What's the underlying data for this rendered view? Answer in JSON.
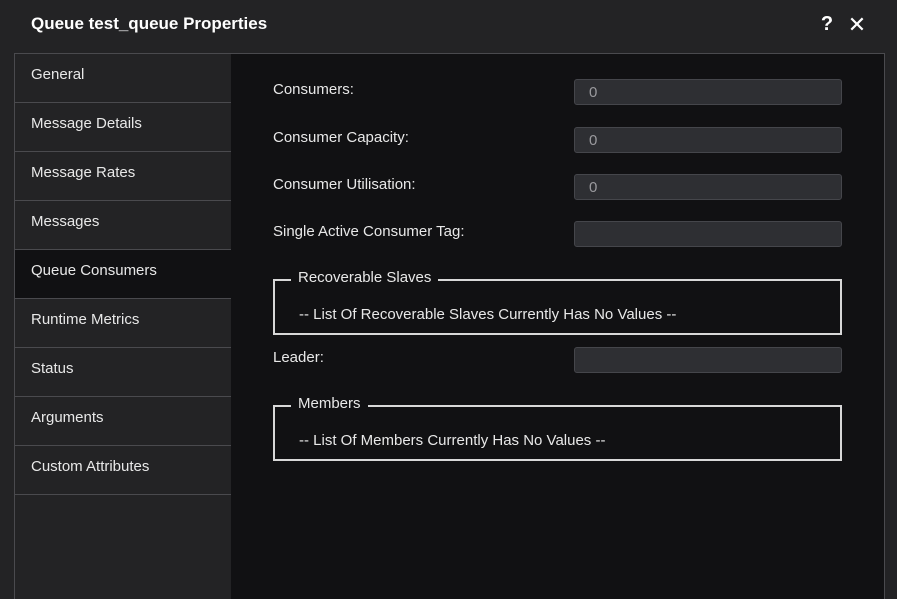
{
  "window": {
    "title": "Queue test_queue Properties",
    "help_icon": "question-mark-icon",
    "close_icon": "close-icon"
  },
  "sidebar": {
    "items": [
      {
        "label": "General",
        "active": false
      },
      {
        "label": "Message Details",
        "active": false
      },
      {
        "label": "Message Rates",
        "active": false
      },
      {
        "label": "Messages",
        "active": false
      },
      {
        "label": "Queue Consumers",
        "active": true
      },
      {
        "label": "Runtime Metrics",
        "active": false
      },
      {
        "label": "Status",
        "active": false
      },
      {
        "label": "Arguments",
        "active": false
      },
      {
        "label": "Custom Attributes",
        "active": false
      }
    ]
  },
  "main": {
    "fields": {
      "consumers": {
        "label": "Consumers:",
        "value": "0"
      },
      "consumer_capacity": {
        "label": "Consumer Capacity:",
        "value": "0"
      },
      "consumer_utilisation": {
        "label": "Consumer Utilisation:",
        "value": "0"
      },
      "single_active_consumer_tag": {
        "label": "Single Active Consumer Tag:",
        "value": ""
      },
      "leader": {
        "label": "Leader:",
        "value": ""
      }
    },
    "recoverable_slaves": {
      "legend": "Recoverable Slaves",
      "empty_text": "-- List Of Recoverable Slaves Currently Has No Values --"
    },
    "members": {
      "legend": "Members",
      "empty_text": "-- List Of Members Currently Has No Values --"
    }
  },
  "colors": {
    "window_bg": "#232325",
    "content_bg": "#111113",
    "input_bg": "#2e2f33",
    "border": "#4a4a4e"
  }
}
